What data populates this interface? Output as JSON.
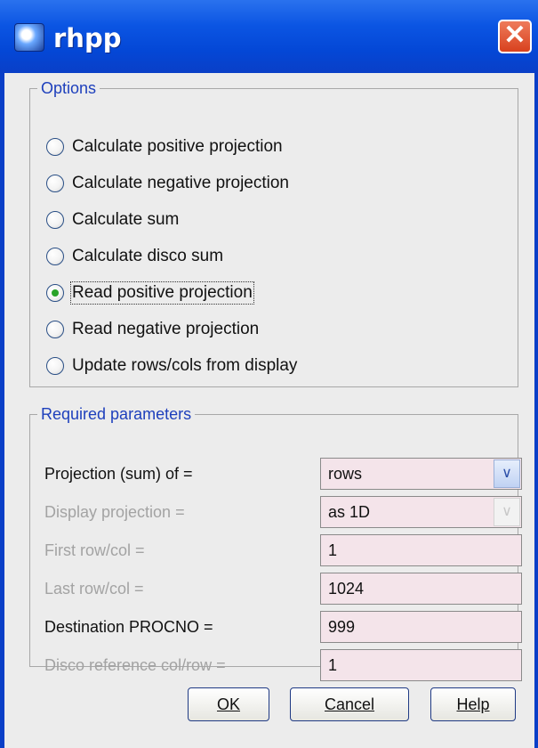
{
  "window": {
    "title": "rhpp"
  },
  "options": {
    "legend": "Options",
    "items": [
      {
        "label": "Calculate positive projection",
        "selected": false
      },
      {
        "label": "Calculate negative projection",
        "selected": false
      },
      {
        "label": "Calculate sum",
        "selected": false
      },
      {
        "label": "Calculate disco sum",
        "selected": false
      },
      {
        "label": "Read positive projection",
        "selected": true
      },
      {
        "label": "Read negative projection",
        "selected": false
      },
      {
        "label": "Update rows/cols from display",
        "selected": false
      }
    ]
  },
  "params": {
    "legend": "Required parameters",
    "rows": [
      {
        "label": "Projection (sum) of =",
        "value": "rows",
        "enabled": true,
        "dropdown": true
      },
      {
        "label": "Display projection =",
        "value": "as 1D",
        "enabled": false,
        "dropdown": true
      },
      {
        "label": "First row/col =",
        "value": "1",
        "enabled": false
      },
      {
        "label": "Last row/col =",
        "value": "1024",
        "enabled": false
      },
      {
        "label": "Destination PROCNO =",
        "value": "999",
        "enabled": true
      },
      {
        "label": "Disco reference col/row =",
        "value": "1",
        "enabled": false
      }
    ]
  },
  "buttons": {
    "ok": "OK",
    "cancel": "Cancel",
    "help": "Help"
  },
  "icons": {
    "app": "rhpp-app-icon",
    "close": "close-icon",
    "dropdown": "chevron-down-icon"
  },
  "colors": {
    "titlebar": "#0b55e3",
    "legend": "#1d3fbc",
    "field_bg": "#f4e4ea",
    "close": "#d8411e",
    "radio_selected": "#29a329"
  }
}
